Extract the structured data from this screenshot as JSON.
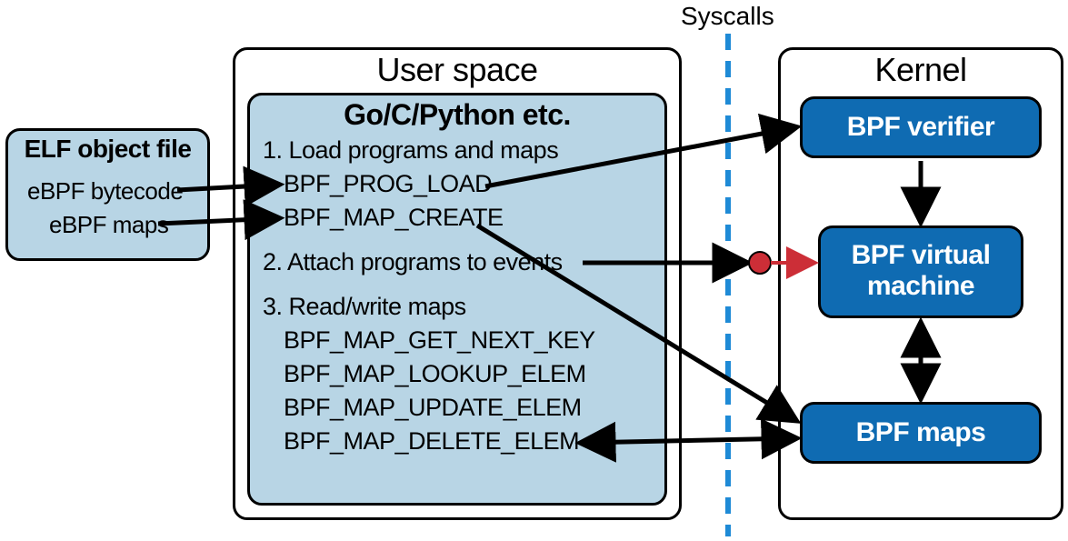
{
  "labels": {
    "syscalls": "Syscalls",
    "user_space": "User space",
    "kernel": "Kernel",
    "elf_title": "ELF object file",
    "gcp_title": "Go/C/Python etc.",
    "elf_bytecode": "eBPF bytecode",
    "elf_maps": "eBPF maps",
    "step1": "1. Load programs and maps",
    "step1a": "BPF_PROG_LOAD",
    "step1b": "BPF_MAP_CREATE",
    "step2": "2. Attach programs to events",
    "step3": "3. Read/write maps",
    "step3a": "BPF_MAP_GET_NEXT_KEY",
    "step3b": "BPF_MAP_LOOKUP_ELEM",
    "step3c": "BPF_MAP_UPDATE_ELEM",
    "step3d": "BPF_MAP_DELETE_ELEM",
    "bpf_verifier": "BPF verifier",
    "bpf_vm1": "BPF virtual",
    "bpf_vm2": "machine",
    "bpf_maps": "BPF maps"
  },
  "colors": {
    "lightblue": "#B8D5E5",
    "blue": "#0F6BB2",
    "dashed": "#1E8AD6",
    "red": "#CC2E37",
    "black": "#000000"
  }
}
